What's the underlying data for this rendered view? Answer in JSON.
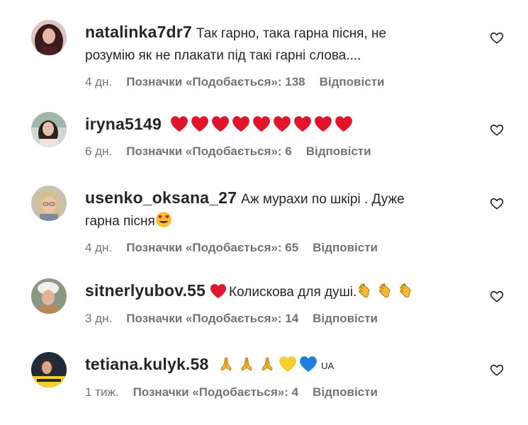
{
  "comments": [
    {
      "username": "natalinka7dr7",
      "text": "Так гарно, така гарна пісня, не",
      "text2": "розумію як не плакати під такі гарні слова....",
      "time": "4 дн.",
      "likes": "Позначки «Подобається»: 138",
      "reply": "Відповісти",
      "avatar_icon": "avatar-dark-hair-woman"
    },
    {
      "username": "iryna5149",
      "text": "",
      "emojis": [
        "red-heart",
        "red-heart",
        "red-heart",
        "red-heart",
        "red-heart",
        "red-heart",
        "red-heart",
        "red-heart",
        "red-heart"
      ],
      "time": "6 дн.",
      "likes": "Позначки «Подобається»: 6",
      "reply": "Відповісти",
      "avatar_icon": "avatar-woman-outdoor"
    },
    {
      "username": "usenko_oksana_27",
      "text": "Аж мурахи по шкірі . Дуже",
      "text2": "гарна пісня",
      "emoji_after_text2": "heart-eyes",
      "time": "4 дн.",
      "likes": "Позначки «Подобається»: 65",
      "reply": "Відповісти",
      "avatar_icon": "avatar-blonde-woman-glasses"
    },
    {
      "username": "sitnerlyubov.55",
      "text": "Колискова для душі.",
      "emoji_before_text": "red-heart",
      "emojis_after_text": [
        "clapping-hands",
        "clapping-hands",
        "clapping-hands"
      ],
      "time": "3 дн.",
      "likes": "Позначки «Подобається»: 14",
      "reply": "Відповісти",
      "avatar_icon": "avatar-woman-white-hat"
    },
    {
      "username": "tetiana.kulyk.58",
      "emojis": [
        "folded-hands",
        "folded-hands",
        "folded-hands",
        "yellow-heart",
        "blue-heart"
      ],
      "flag_text": "UA",
      "time": "1 тиж.",
      "likes": "Позначки «Подобається»: 4",
      "reply": "Відповісти",
      "avatar_icon": "avatar-woman-yellow-banner"
    }
  ],
  "colors": {
    "username": "#262626",
    "meta": "#737373",
    "heart_red": "#e0142c",
    "yellow_heart": "#f7cf2b",
    "blue_heart": "#1b7fe0",
    "clap": "#f5b93a"
  },
  "like_icon": "heart-outline-icon"
}
